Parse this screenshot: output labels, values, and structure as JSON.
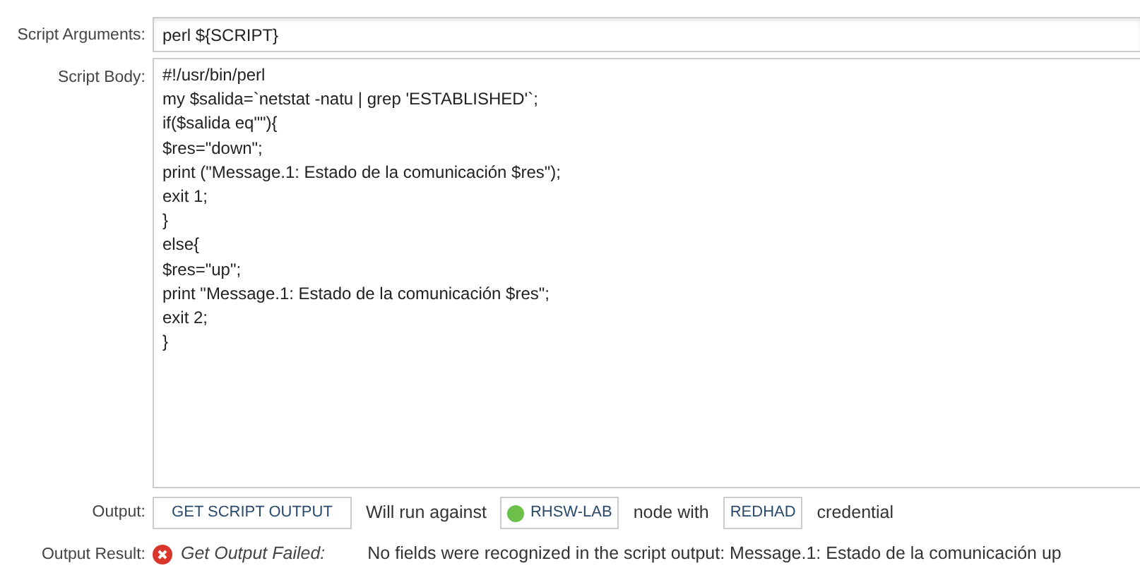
{
  "script_arguments": {
    "label": "Script Arguments:",
    "value": "perl ${SCRIPT}"
  },
  "script_body": {
    "label": "Script Body:",
    "lines": [
      "#!/usr/bin/perl",
      "my $salida=`netstat -natu | grep 'ESTABLISHED'`;",
      "if($salida eq\"\"){",
      "$res=\"down\";",
      "print (\"Message.1: Estado de la comunicación $res\");",
      "exit 1;",
      "}",
      "else{",
      "$res=\"up\";",
      "print \"Message.1: Estado de la comunicación $res\";",
      "exit 2;",
      "}"
    ]
  },
  "output": {
    "label": "Output:",
    "button": "GET SCRIPT OUTPUT",
    "text_before": "Will run against",
    "node": {
      "name": "RHSW-LAB",
      "online": true
    },
    "text_middle": "node with",
    "credential": "REDHAD",
    "text_after": "credential"
  },
  "output_result": {
    "label": "Output Result:",
    "failed": true,
    "status_text": "Get Output Failed:",
    "message": "No fields were recognized in the script output: Message.1: Estado de la comunicación up"
  }
}
